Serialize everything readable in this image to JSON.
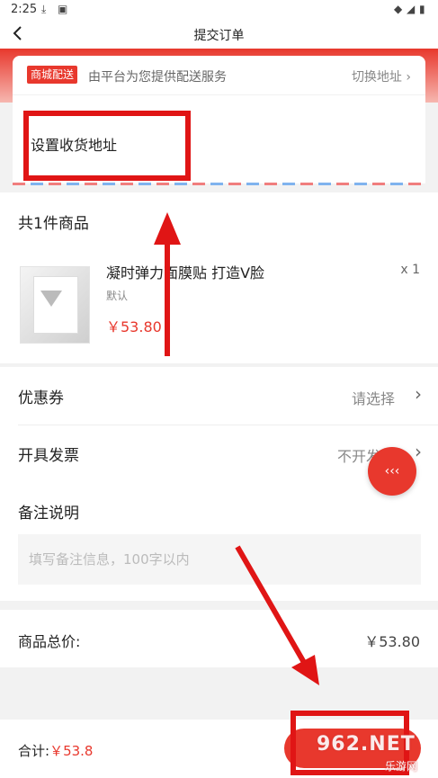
{
  "status_bar": {
    "time": "2:25"
  },
  "header": {
    "back_icon": "chevron-left-icon",
    "title": "提交订单"
  },
  "address": {
    "tag": "商城配送",
    "service": "由平台为您提供配送服务",
    "switch": "切换地址",
    "set_address": "设置收货地址"
  },
  "goods": {
    "count_label": "共1件商品",
    "name": "凝时弹力面膜贴 打造V脸",
    "quantity": "x 1",
    "spec": "默认",
    "price": "￥53.80"
  },
  "options": {
    "coupon_label": "优惠券",
    "coupon_value": "请选择",
    "invoice_label": "开具发票",
    "invoice_value": "不开发票",
    "remark_label": "备注说明",
    "remark_placeholder": "填写备注信息，100字以内"
  },
  "total": {
    "label": "商品总价:",
    "value": "￥53.80"
  },
  "bottom": {
    "sum_label": "合计:",
    "sum_value": "￥53.8"
  },
  "watermark": {
    "main": "962.NET",
    "sub": "乐游网"
  },
  "colors": {
    "accent": "#e8382d",
    "annotation": "#e01515"
  }
}
